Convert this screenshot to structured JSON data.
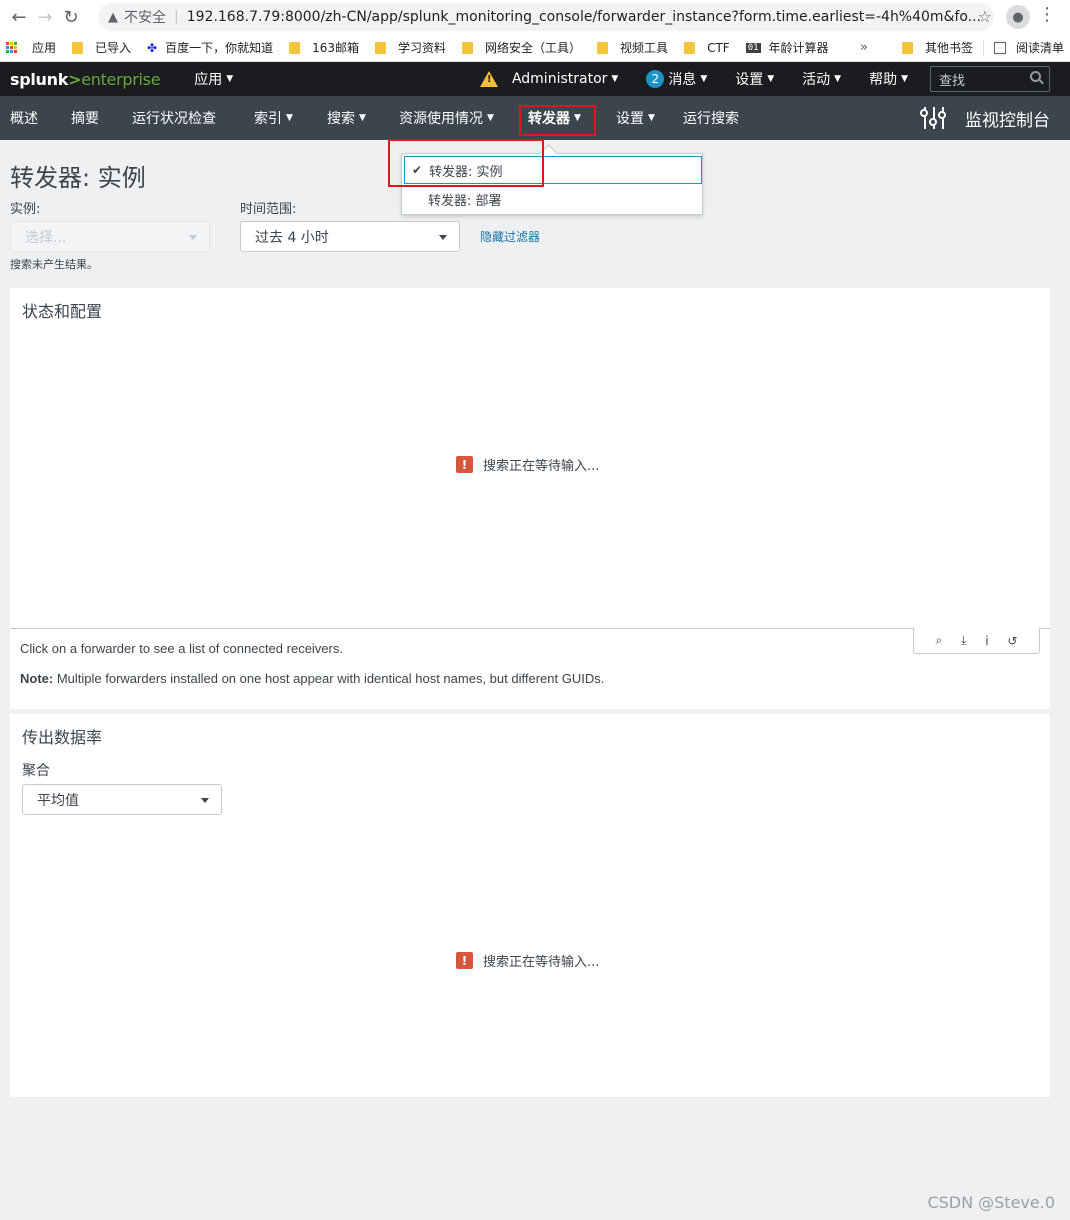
{
  "browser": {
    "insecure_label": "不安全",
    "url": "192.168.7.79:8000/zh-CN/app/splunk_monitoring_console/forwarder_instance?form.time.earliest=-4h%40m&fo..."
  },
  "bookmarks": {
    "items": [
      "应用",
      "已导入",
      "百度一下，你就知道",
      "163邮箱",
      "学习资料",
      "网络安全（工具）",
      "视频工具",
      "CTF",
      "年龄计算器"
    ],
    "more": "»",
    "right": [
      "其他书签",
      "阅读清单"
    ],
    "bin_icon_text": "01"
  },
  "splunk_top": {
    "logo_main": "splunk",
    "logo_gt": ">",
    "logo_sub": "enterprise",
    "apps_label": "应用",
    "admin_label": "Administrator",
    "messages_count": "2",
    "messages_label": "消息",
    "settings_label": "设置",
    "activity_label": "活动",
    "help_label": "帮助",
    "search_placeholder": "查找"
  },
  "app_nav": {
    "items": [
      "概述",
      "摘要",
      "运行状况检查",
      "索引",
      "搜索",
      "资源使用情况",
      "转发器",
      "设置",
      "运行搜索"
    ],
    "console_title": "监视控制台"
  },
  "dropdown": {
    "items": [
      "转发器: 实例",
      "转发器: 部署"
    ],
    "selected_index": 0
  },
  "page": {
    "title": "转发器: 实例",
    "instance_label": "实例:",
    "instance_placeholder": "选择...",
    "time_label": "时间范围:",
    "time_value": "过去 4 小时",
    "hide_filters": "隐藏过滤器",
    "no_results": "搜索未产生结果。"
  },
  "panel1": {
    "title": "状态和配置",
    "waiting": "搜索正在等待输入...",
    "note1": "Click on a forwarder to see a list of connected receivers.",
    "note2_bold": "Note:",
    "note2_rest": " Multiple forwarders installed on one host appear with identical host names, but different GUIDs."
  },
  "panel2": {
    "title": "传出数据率",
    "agg_label": "聚合",
    "agg_value": "平均值",
    "waiting": "搜索正在等待输入..."
  },
  "watermark": "CSDN @Steve.0",
  "colors": {
    "highlight": "#e0161b",
    "splunk_green": "#65a637",
    "top_bar": "#1a1c20",
    "nav_bar": "#3c444d",
    "error": "#d6563c",
    "link": "#1a73a8"
  }
}
